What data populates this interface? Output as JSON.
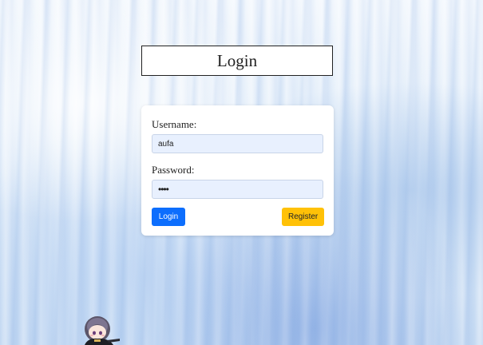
{
  "header": {
    "title": "Login"
  },
  "form": {
    "username_label": "Username:",
    "username_value": "aufa",
    "password_label": "Password:",
    "password_value": "aufa",
    "login_button": "Login",
    "register_button": "Register"
  },
  "colors": {
    "login_button_bg": "#0d6efd",
    "register_button_bg": "#ffc107",
    "input_bg": "#e8f0fe",
    "background_tint": "#bfd6f1"
  },
  "icons": {
    "mascot": "anime-chibi-character"
  }
}
